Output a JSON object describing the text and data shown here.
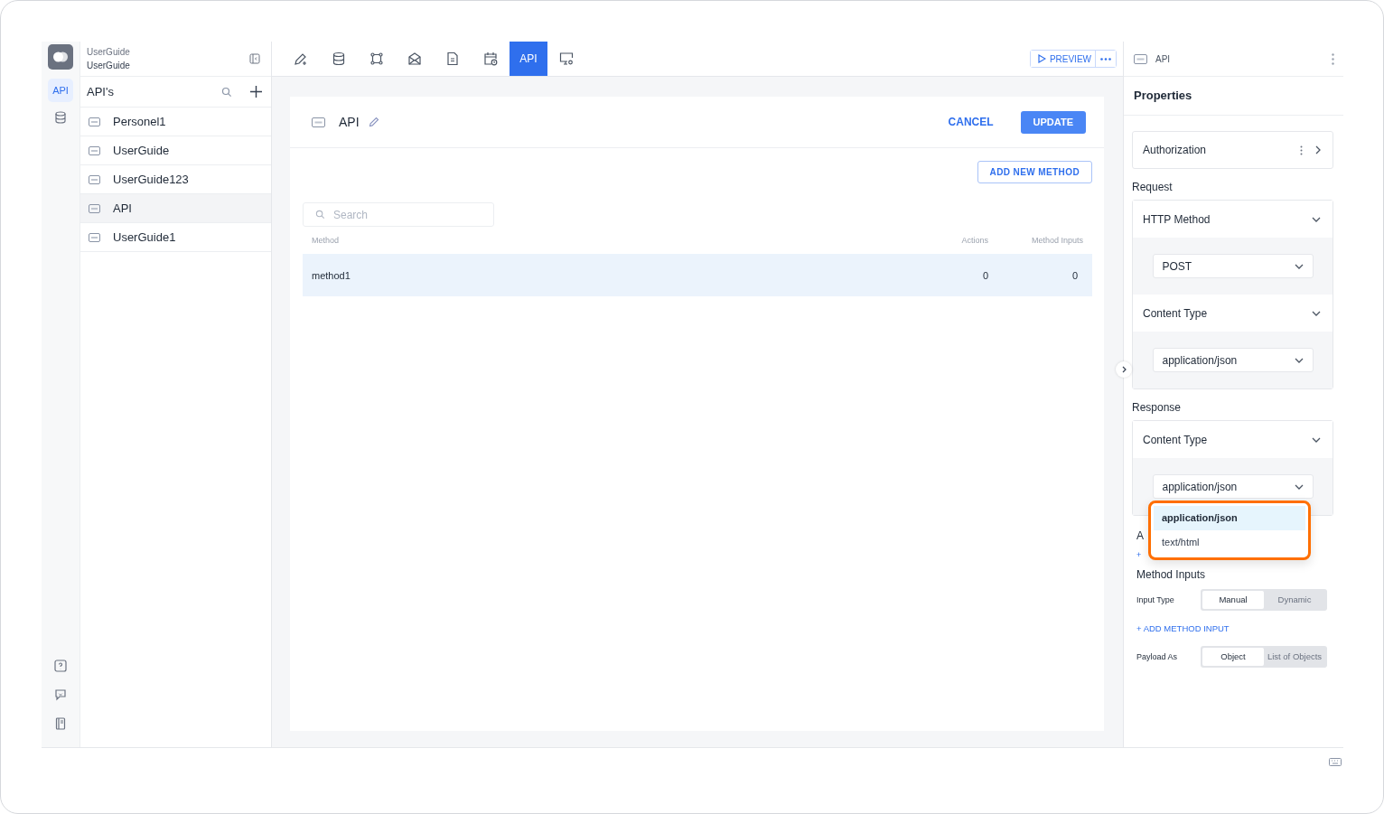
{
  "rail": {
    "items": [
      {
        "kind": "text",
        "label": "API",
        "selected": true
      },
      {
        "kind": "database",
        "selected": false
      }
    ],
    "bottom": [
      {
        "kind": "help"
      },
      {
        "kind": "chat"
      },
      {
        "kind": "book"
      }
    ]
  },
  "project": {
    "subtitle": "UserGuide",
    "title": "UserGuide"
  },
  "toolbar": {
    "tabs": [
      {
        "kind": "pencil",
        "selected": false
      },
      {
        "kind": "database",
        "selected": false
      },
      {
        "kind": "graph",
        "selected": false
      },
      {
        "kind": "mail",
        "selected": false
      },
      {
        "kind": "document",
        "selected": false
      },
      {
        "kind": "calendar",
        "selected": false
      },
      {
        "kind": "text",
        "label": "API",
        "selected": true
      },
      {
        "kind": "monitor",
        "selected": false
      }
    ],
    "preview": "PREVIEW"
  },
  "sidebar": {
    "title": "API's",
    "items": [
      {
        "label": "Personel1",
        "selected": false
      },
      {
        "label": "UserGuide",
        "selected": false
      },
      {
        "label": "UserGuide123",
        "selected": false
      },
      {
        "label": "API",
        "selected": true
      },
      {
        "label": "UserGuide1",
        "selected": false
      }
    ]
  },
  "editor": {
    "title": "API",
    "cancel": "CANCEL",
    "update": "UPDATE",
    "add_method": "ADD NEW METHOD",
    "search": {
      "placeholder": "Search"
    },
    "table": {
      "columns": [
        "Method",
        "Actions",
        "Method Inputs"
      ],
      "rows": [
        {
          "cells": [
            "method1",
            "0",
            "0"
          ],
          "selected": true
        }
      ]
    }
  },
  "properties": {
    "header": "API",
    "title": "Properties",
    "authorization": "Authorization",
    "sections": [
      {
        "label": "Request",
        "groups": [
          {
            "title": "HTTP Method",
            "value": "POST"
          },
          {
            "title": "Content Type",
            "value": "application/json"
          }
        ]
      },
      {
        "label": "Response",
        "groups": [
          {
            "title": "Content Type",
            "value": "application/json"
          }
        ]
      }
    ],
    "dropdown": {
      "options": [
        {
          "label": "application/json",
          "selected": true
        },
        {
          "label": "text/html",
          "selected": false
        }
      ]
    },
    "hidden_heading": "A",
    "hidden_link": "+",
    "method_inputs": {
      "title": "Method Inputs",
      "input_type": {
        "label": "Input Type",
        "options": [
          {
            "label": "Manual",
            "selected": true
          },
          {
            "label": "Dynamic",
            "selected": false
          }
        ]
      },
      "add_input": "+ ADD METHOD INPUT",
      "payload": {
        "label": "Payload As",
        "options": [
          {
            "label": "Object",
            "selected": true
          },
          {
            "label": "List of Objects",
            "selected": false
          }
        ]
      }
    }
  }
}
